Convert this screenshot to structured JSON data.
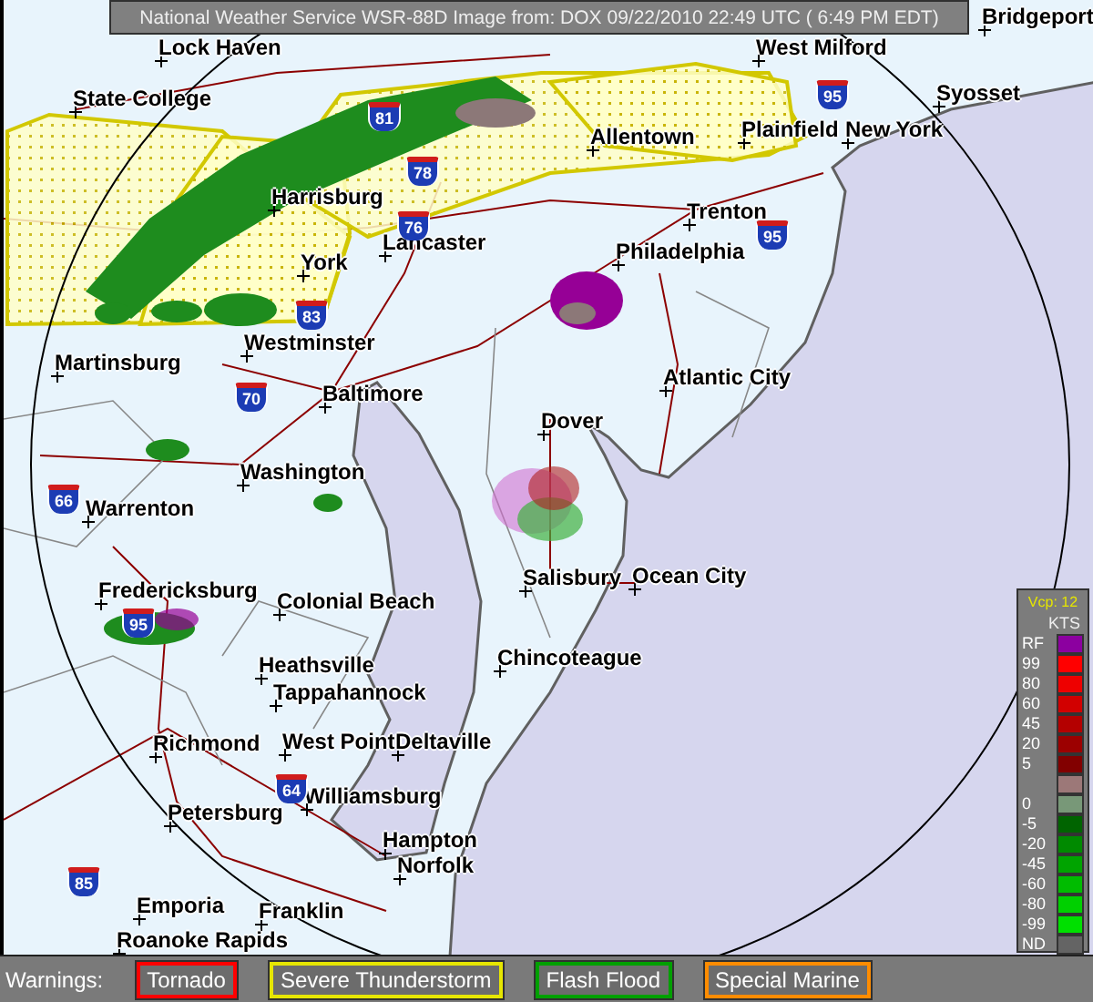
{
  "header": {
    "title": "National Weather Service WSR-88D Image from: DOX 09/22/2010 22:49 UTC ( 6:49 PM EDT)"
  },
  "cities": [
    {
      "name": "Lock Haven"
    },
    {
      "name": "West Milford"
    },
    {
      "name": "Bridgeport"
    },
    {
      "name": "State College"
    },
    {
      "name": "Allentown"
    },
    {
      "name": "Syosset"
    },
    {
      "name": "Plainfield"
    },
    {
      "name": "New York"
    },
    {
      "name": "Harrisburg"
    },
    {
      "name": "Lancaster"
    },
    {
      "name": "York"
    },
    {
      "name": "Trenton"
    },
    {
      "name": "Philadelphia"
    },
    {
      "name": "Westminster"
    },
    {
      "name": "Martinsburg"
    },
    {
      "name": "Baltimore"
    },
    {
      "name": "Atlantic City"
    },
    {
      "name": "Dover"
    },
    {
      "name": "Washington"
    },
    {
      "name": "Warrenton"
    },
    {
      "name": "Salisbury"
    },
    {
      "name": "Ocean City"
    },
    {
      "name": "Fredericksburg"
    },
    {
      "name": "Colonial Beach"
    },
    {
      "name": "Heathsville"
    },
    {
      "name": "Chincoteague"
    },
    {
      "name": "Tappahannock"
    },
    {
      "name": "Richmond"
    },
    {
      "name": "West Point"
    },
    {
      "name": "Deltaville"
    },
    {
      "name": "Williamsburg"
    },
    {
      "name": "Petersburg"
    },
    {
      "name": "Hampton"
    },
    {
      "name": "Norfolk"
    },
    {
      "name": "Emporia"
    },
    {
      "name": "Franklin"
    },
    {
      "name": "Roanoke Rapids"
    }
  ],
  "interstates": [
    "81",
    "78",
    "76",
    "83",
    "70",
    "95",
    "95",
    "95",
    "66",
    "64",
    "85"
  ],
  "legend": {
    "mode": "Vcp: 12",
    "unit": "KTS",
    "entries": [
      {
        "label": "RF",
        "color": "#8c00a0"
      },
      {
        "label": "99",
        "color": "#ff0000"
      },
      {
        "label": "80",
        "color": "#ee0000"
      },
      {
        "label": "60",
        "color": "#d20000"
      },
      {
        "label": "45",
        "color": "#b40000"
      },
      {
        "label": "20",
        "color": "#9c0000"
      },
      {
        "label": "5",
        "color": "#820000"
      },
      {
        "color": "#9c7878"
      },
      {
        "label": "0",
        "color": "#789878"
      },
      {
        "label": "-5",
        "color": "#006400"
      },
      {
        "label": "-20",
        "color": "#008a00"
      },
      {
        "label": "-45",
        "color": "#00a400"
      },
      {
        "label": "-60",
        "color": "#00bc00"
      },
      {
        "label": "-80",
        "color": "#00d000"
      },
      {
        "label": "-99",
        "color": "#00e000"
      },
      {
        "label": "ND",
        "color": "#646464"
      }
    ]
  },
  "warnings": {
    "label": "Warnings:",
    "items": [
      {
        "label": "Tornado",
        "color": "#ff0000"
      },
      {
        "label": "Severe Thunderstorm",
        "color": "#e6e600"
      },
      {
        "label": "Flash Flood",
        "color": "#00a000"
      },
      {
        "label": "Special Marine",
        "color": "#ff8c00"
      }
    ]
  }
}
